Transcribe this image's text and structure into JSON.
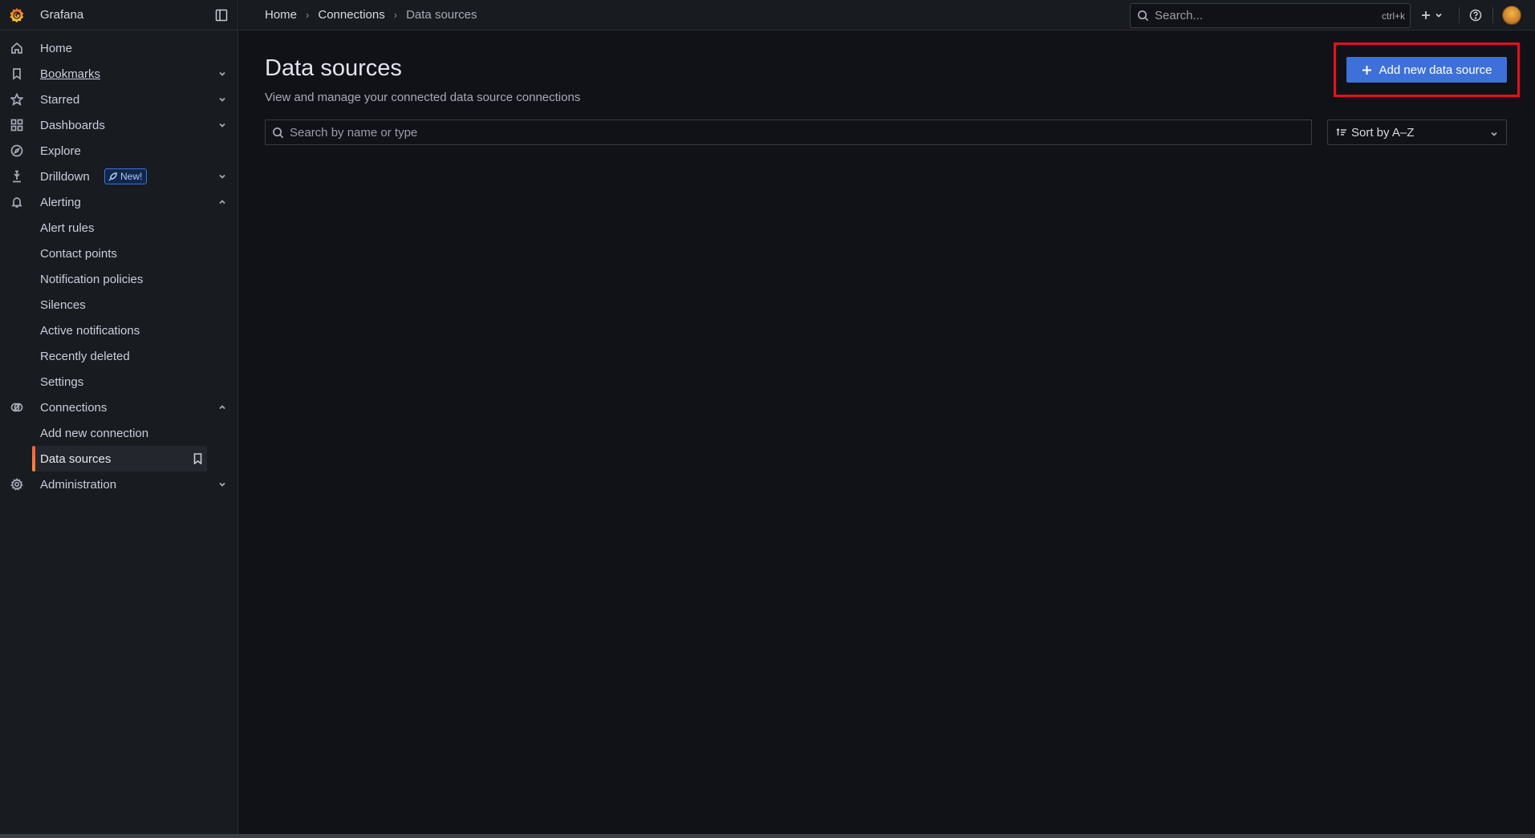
{
  "brand": {
    "title": "Grafana"
  },
  "sidebar": {
    "items": [
      {
        "label": "Home"
      },
      {
        "label": "Bookmarks"
      },
      {
        "label": "Starred"
      },
      {
        "label": "Dashboards"
      },
      {
        "label": "Explore"
      },
      {
        "label": "Drilldown",
        "badge": "New!"
      },
      {
        "label": "Alerting"
      },
      {
        "label": "Connections"
      },
      {
        "label": "Administration"
      }
    ],
    "alerting_children": [
      {
        "label": "Alert rules"
      },
      {
        "label": "Contact points"
      },
      {
        "label": "Notification policies"
      },
      {
        "label": "Silences"
      },
      {
        "label": "Active notifications"
      },
      {
        "label": "Recently deleted"
      },
      {
        "label": "Settings"
      }
    ],
    "connections_children": [
      {
        "label": "Add new connection"
      },
      {
        "label": "Data sources"
      }
    ]
  },
  "topbar": {
    "breadcrumbs": [
      "Home",
      "Connections",
      "Data sources"
    ],
    "search_placeholder": "Search...",
    "search_shortcut": "ctrl+k"
  },
  "main": {
    "title": "Data sources",
    "subtitle": "View and manage your connected data source connections",
    "add_button_label": "Add new data source",
    "search_placeholder": "Search by name or type",
    "sort_label": "Sort by A–Z"
  },
  "colors": {
    "accent": "#3d71d9",
    "active_indicator": "#ff8833",
    "highlight_box": "#e3121b"
  }
}
